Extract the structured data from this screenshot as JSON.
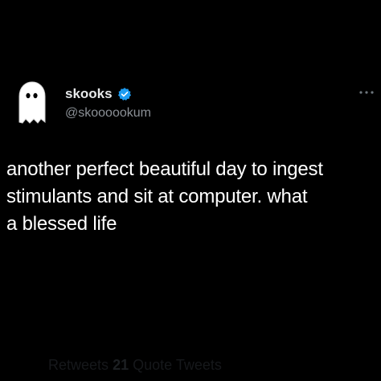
{
  "user": {
    "display_name": "skooks",
    "handle": "@skoooookum",
    "verified_icon": "verified-badge-icon",
    "avatar_icon": "ghost-avatar-icon"
  },
  "tweet": {
    "lines": [
      "another perfect beautiful day to ingest",
      "stimulants and sit at computer. what",
      "a blessed life"
    ]
  },
  "footer": {
    "stats_prefix": "Retweets",
    "quote_count": "21",
    "quote_label": "Quote Tweets"
  },
  "colors": {
    "background": "#000000",
    "text": "#ffffff",
    "secondary_text": "#8b9096",
    "verified": "#1d9bf0"
  },
  "icons": {
    "more": "more-dots-icon"
  }
}
